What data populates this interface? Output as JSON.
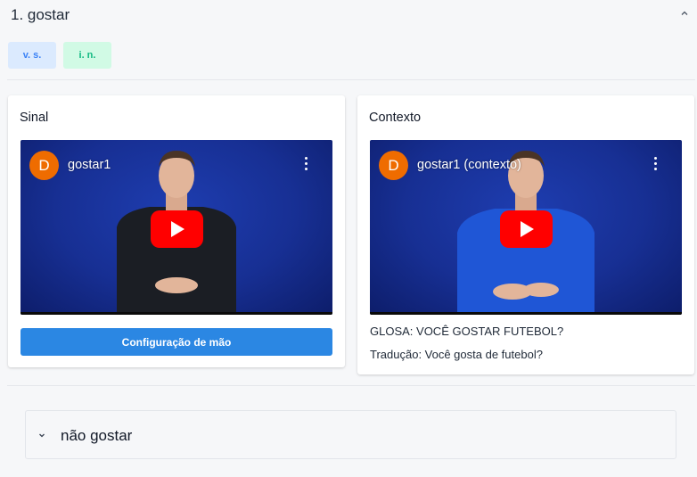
{
  "entry": {
    "title": "1. gostar",
    "collapse_icon": "chevron-up-icon"
  },
  "tags": [
    {
      "label": "v. s.",
      "color": "#3b82f6",
      "bg": "#dbeafe"
    },
    {
      "label": "i. n.",
      "color": "#10b981",
      "bg": "#d1fae5"
    }
  ],
  "sinal": {
    "title": "Sinal",
    "video": {
      "channel_initial": "D",
      "title": "gostar1",
      "shirt_color": "#1b1e24"
    },
    "button_label": "Configuração de mão",
    "button_color": "#2b87e3"
  },
  "contexto": {
    "title": "Contexto",
    "video": {
      "channel_initial": "D",
      "title": "gostar1 (contexto)",
      "shirt_color": "#1f56d6"
    },
    "glosa": "GLOSA: VOCÊ GOSTAR FUTEBOL?",
    "traducao": "Tradução: Você gosta de futebol?"
  },
  "sub_entry": {
    "title": "não gostar",
    "icon": "chevron-down-icon"
  },
  "colors": {
    "video_bg": "#172f93",
    "youtube_red": "#ff0000",
    "avatar_orange": "#ef6c00"
  }
}
